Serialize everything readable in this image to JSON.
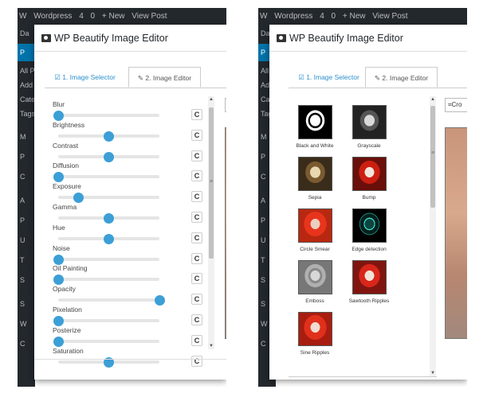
{
  "wp_admin": {
    "bar_items": [
      "W",
      "Wordpress",
      "4",
      "0",
      "+ New",
      "View Post"
    ],
    "left_menu": [
      "Da",
      "P",
      "All P",
      "Add N",
      "Categ",
      "Tags",
      "M",
      "P",
      "C",
      "A",
      "P",
      "U",
      "T",
      "S",
      "S",
      "W",
      "C"
    ]
  },
  "modal": {
    "title": "WP Beautify Image Editor",
    "tabs": [
      "1. Image Selector",
      "2. Image Editor"
    ],
    "crop_label_left": "Cr",
    "crop_label_right": "Cro"
  },
  "editor": {
    "reset_glyph": "C",
    "sliders": [
      {
        "label": "Blur",
        "value": 0
      },
      {
        "label": "Brightness",
        "value": 50
      },
      {
        "label": "Contrast",
        "value": 50
      },
      {
        "label": "Diffusion",
        "value": 0
      },
      {
        "label": "Exposure",
        "value": 20
      },
      {
        "label": "Gamma",
        "value": 50
      },
      {
        "label": "Hue",
        "value": 50
      },
      {
        "label": "Noise",
        "value": 0
      },
      {
        "label": "Oil Painting",
        "value": 0
      },
      {
        "label": "Opacity",
        "value": 100
      },
      {
        "label": "Pixelation",
        "value": 0
      },
      {
        "label": "Posterize",
        "value": 0
      },
      {
        "label": "Saturation",
        "value": 50
      }
    ]
  },
  "filters": [
    {
      "name": "Black and White",
      "icon": "bw-mask-thumbnail"
    },
    {
      "name": "Grayscale",
      "icon": "grayscale-mask-thumbnail"
    },
    {
      "name": "Sepia",
      "icon": "sepia-mask-thumbnail"
    },
    {
      "name": "Bump",
      "icon": "bump-mask-thumbnail"
    },
    {
      "name": "Circle Smear",
      "icon": "circle-smear-mask-thumbnail"
    },
    {
      "name": "Edge detection",
      "icon": "edge-detection-mask-thumbnail"
    },
    {
      "name": "Emboss",
      "icon": "emboss-mask-thumbnail"
    },
    {
      "name": "Sawtooth Ripples",
      "icon": "sawtooth-ripples-mask-thumbnail"
    },
    {
      "name": "Sine Ripples",
      "icon": "sine-ripples-mask-thumbnail"
    }
  ],
  "colors": {
    "accent": "#3c9fd6",
    "tab_active_text": "#2a8fcc",
    "admin_bar": "#23282d",
    "admin_menu_active": "#0073aa"
  }
}
